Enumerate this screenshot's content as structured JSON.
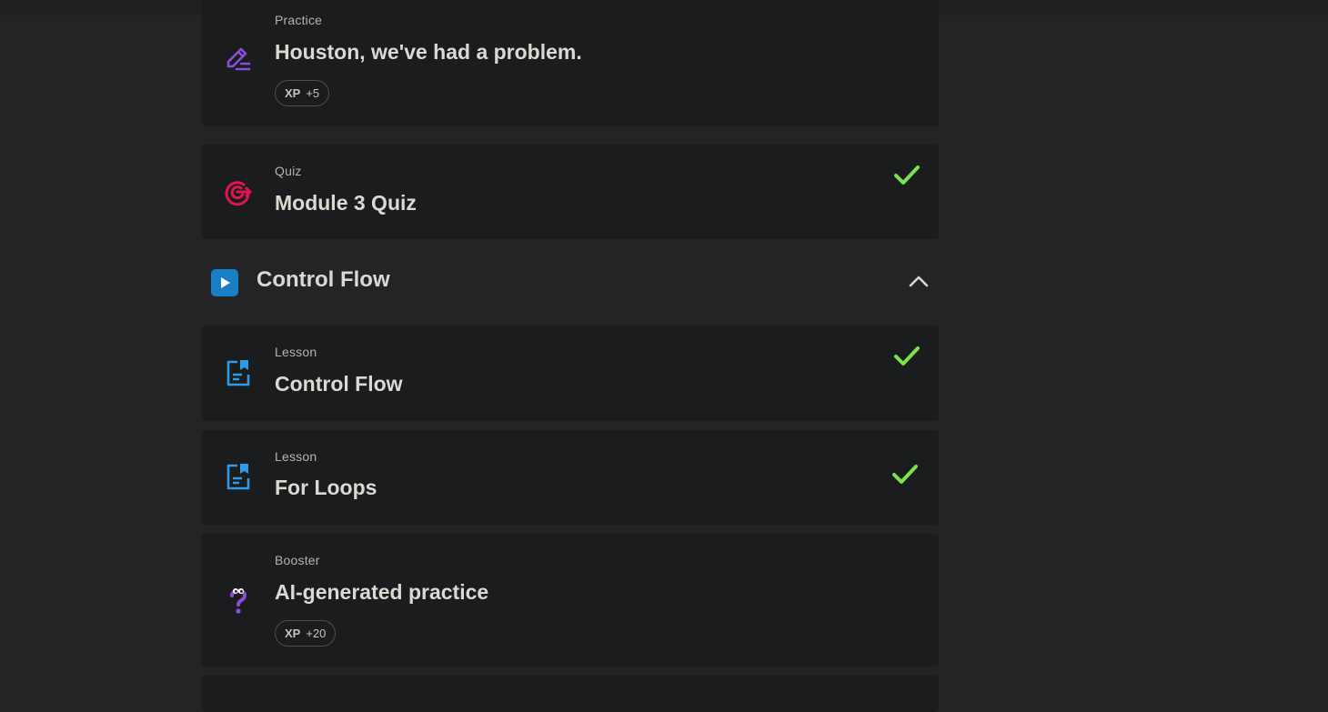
{
  "items_top": [
    {
      "kind": "Practice",
      "title": "Houston, we've had a problem.",
      "xp_label": "XP",
      "xp_value": "+5",
      "icon": "pencil-icon",
      "completed": false
    },
    {
      "kind": "Quiz",
      "title": "Module 3 Quiz",
      "icon": "target-icon",
      "completed": true
    }
  ],
  "section": {
    "title": "Control Flow",
    "expanded": true,
    "icon": "play-icon"
  },
  "items_section": [
    {
      "kind": "Lesson",
      "title": "Control Flow",
      "icon": "lesson-icon",
      "completed": true
    },
    {
      "kind": "Lesson",
      "title": "For Loops",
      "icon": "lesson-icon",
      "completed": true
    },
    {
      "kind": "Booster",
      "title": "AI-generated practice",
      "xp_label": "XP",
      "xp_value": "+20",
      "icon": "question-mark-icon",
      "completed": false
    }
  ],
  "colors": {
    "background": "#232426",
    "card": "#1b1c1e",
    "check": "#79e34d",
    "lesson_icon": "#2d9be8",
    "practice_icon": "#8a4fd9",
    "quiz_icon": "#e0154f",
    "section_icon": "#1a7ec4"
  }
}
